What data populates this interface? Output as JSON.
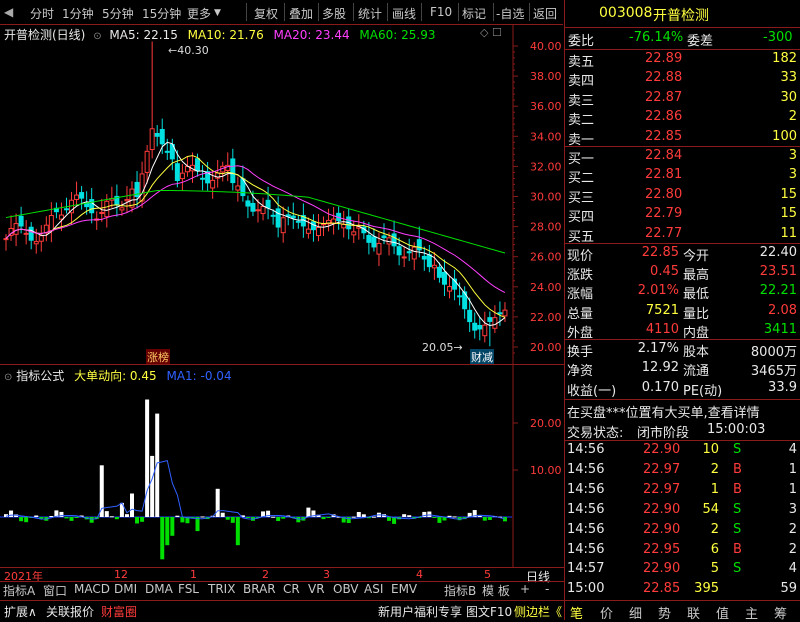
{
  "toolbar": {
    "left_items": [
      "分时",
      "1分钟",
      "5分钟",
      "15分钟",
      "更多"
    ],
    "right_items": [
      "复权",
      "叠加",
      "多股",
      "统计",
      "画线",
      "F10",
      "标记",
      "-自选",
      "返回"
    ]
  },
  "chart_header": {
    "name": "开普检测(日线)",
    "ma5": "MA5: 22.15",
    "ma10": "MA10: 21.76",
    "ma20": "MA20: 23.44",
    "ma60": "MA60: 25.93"
  },
  "annotations": {
    "high": "40.30",
    "low": "20.05",
    "marker_left": "涨榜",
    "marker_right": "财减"
  },
  "indicator_header": {
    "label": "指标公式",
    "main": "大单动向: 0.45",
    "ma1": "MA1: -0.04"
  },
  "axis": {
    "price_ticks": [
      "40.00",
      "38.00",
      "36.00",
      "34.00",
      "32.00",
      "30.00",
      "28.00",
      "26.00",
      "24.00",
      "22.00",
      "20.00"
    ],
    "ind_ticks": [
      "20.00",
      "10.00"
    ],
    "time_labels": [
      "2021年",
      "12",
      "1",
      "2",
      "3",
      "4",
      "5"
    ],
    "period": "日线"
  },
  "bottom_tabs": [
    "指标A",
    "窗口",
    "MACD",
    "DMI",
    "DMA",
    "FSL",
    "TRIX",
    "BRAR",
    "CR",
    "VR",
    "OBV",
    "ASI",
    "EMV",
    "指标B",
    "模 板",
    "+",
    "-"
  ],
  "status_bar": {
    "left": [
      "扩展∧",
      "关联报价",
      "财富圈"
    ],
    "right": [
      "新用户福利专享",
      "图文F10",
      "侧边栏《"
    ]
  },
  "quote": {
    "code": "003008",
    "name": "开普检测",
    "weibi_label": "委比",
    "weibi": "-76.14%",
    "weicha_label": "委差",
    "weicha": "-300",
    "sell": [
      {
        "label": "卖五",
        "price": "22.89",
        "vol": "182"
      },
      {
        "label": "卖四",
        "price": "22.88",
        "vol": "33"
      },
      {
        "label": "卖三",
        "price": "22.87",
        "vol": "30"
      },
      {
        "label": "卖二",
        "price": "22.86",
        "vol": "2"
      },
      {
        "label": "卖一",
        "price": "22.85",
        "vol": "100"
      }
    ],
    "buy": [
      {
        "label": "买一",
        "price": "22.84",
        "vol": "3"
      },
      {
        "label": "买二",
        "price": "22.81",
        "vol": "3"
      },
      {
        "label": "买三",
        "price": "22.80",
        "vol": "15"
      },
      {
        "label": "买四",
        "price": "22.79",
        "vol": "15"
      },
      {
        "label": "买五",
        "price": "22.77",
        "vol": "11"
      }
    ],
    "stats": [
      {
        "l1": "现价",
        "v1": "22.85",
        "l2": "今开",
        "v2": "22.40"
      },
      {
        "l1": "涨跌",
        "v1": "0.45",
        "l2": "最高",
        "v2": "23.51"
      },
      {
        "l1": "涨幅",
        "v1": "2.01%",
        "l2": "最低",
        "v2": "22.21"
      },
      {
        "l1": "总量",
        "v1": "7521",
        "l2": "量比",
        "v2": "2.08"
      },
      {
        "l1": "外盘",
        "v1": "4110",
        "l2": "内盘",
        "v2": "3411"
      }
    ],
    "fund": [
      {
        "l1": "换手",
        "v1": "2.17%",
        "l2": "股本",
        "v2": "8000万"
      },
      {
        "l1": "净资",
        "v1": "12.92",
        "l2": "流通",
        "v2": "3465万"
      },
      {
        "l1": "收益(一)",
        "v1": "0.170",
        "l2": "PE(动)",
        "v2": "33.9"
      }
    ],
    "notice": "在买盘***位置有大买单,查看详情",
    "state_label": "交易状态:",
    "state": "闭市阶段",
    "state_time": "15:00:03"
  },
  "ticks": [
    {
      "time": "14:56",
      "price": "22.90",
      "vol": "10",
      "side": "S",
      "n": "4"
    },
    {
      "time": "14:56",
      "price": "22.97",
      "vol": "2",
      "side": "B",
      "n": "1"
    },
    {
      "time": "14:56",
      "price": "22.97",
      "vol": "1",
      "side": "B",
      "n": "1"
    },
    {
      "time": "14:56",
      "price": "22.90",
      "vol": "54",
      "side": "S",
      "n": "3"
    },
    {
      "time": "14:56",
      "price": "22.90",
      "vol": "2",
      "side": "S",
      "n": "2"
    },
    {
      "time": "14:56",
      "price": "22.95",
      "vol": "6",
      "side": "B",
      "n": "2"
    },
    {
      "time": "14:57",
      "price": "22.90",
      "vol": "5",
      "side": "S",
      "n": "4"
    },
    {
      "time": "15:00",
      "price": "22.85",
      "vol": "395",
      "side": "",
      "n": "59"
    }
  ],
  "right_tabs": [
    "笔",
    "价",
    "细",
    "势",
    "联",
    "值",
    "主",
    "筹"
  ],
  "colors": {
    "up": "#ff3b3b",
    "down": "#00e000",
    "frame": "#8b1a1a",
    "ma5": "#ffffff",
    "ma10": "#ffff40",
    "ma20": "#ff40ff",
    "ma60": "#00e000"
  }
}
